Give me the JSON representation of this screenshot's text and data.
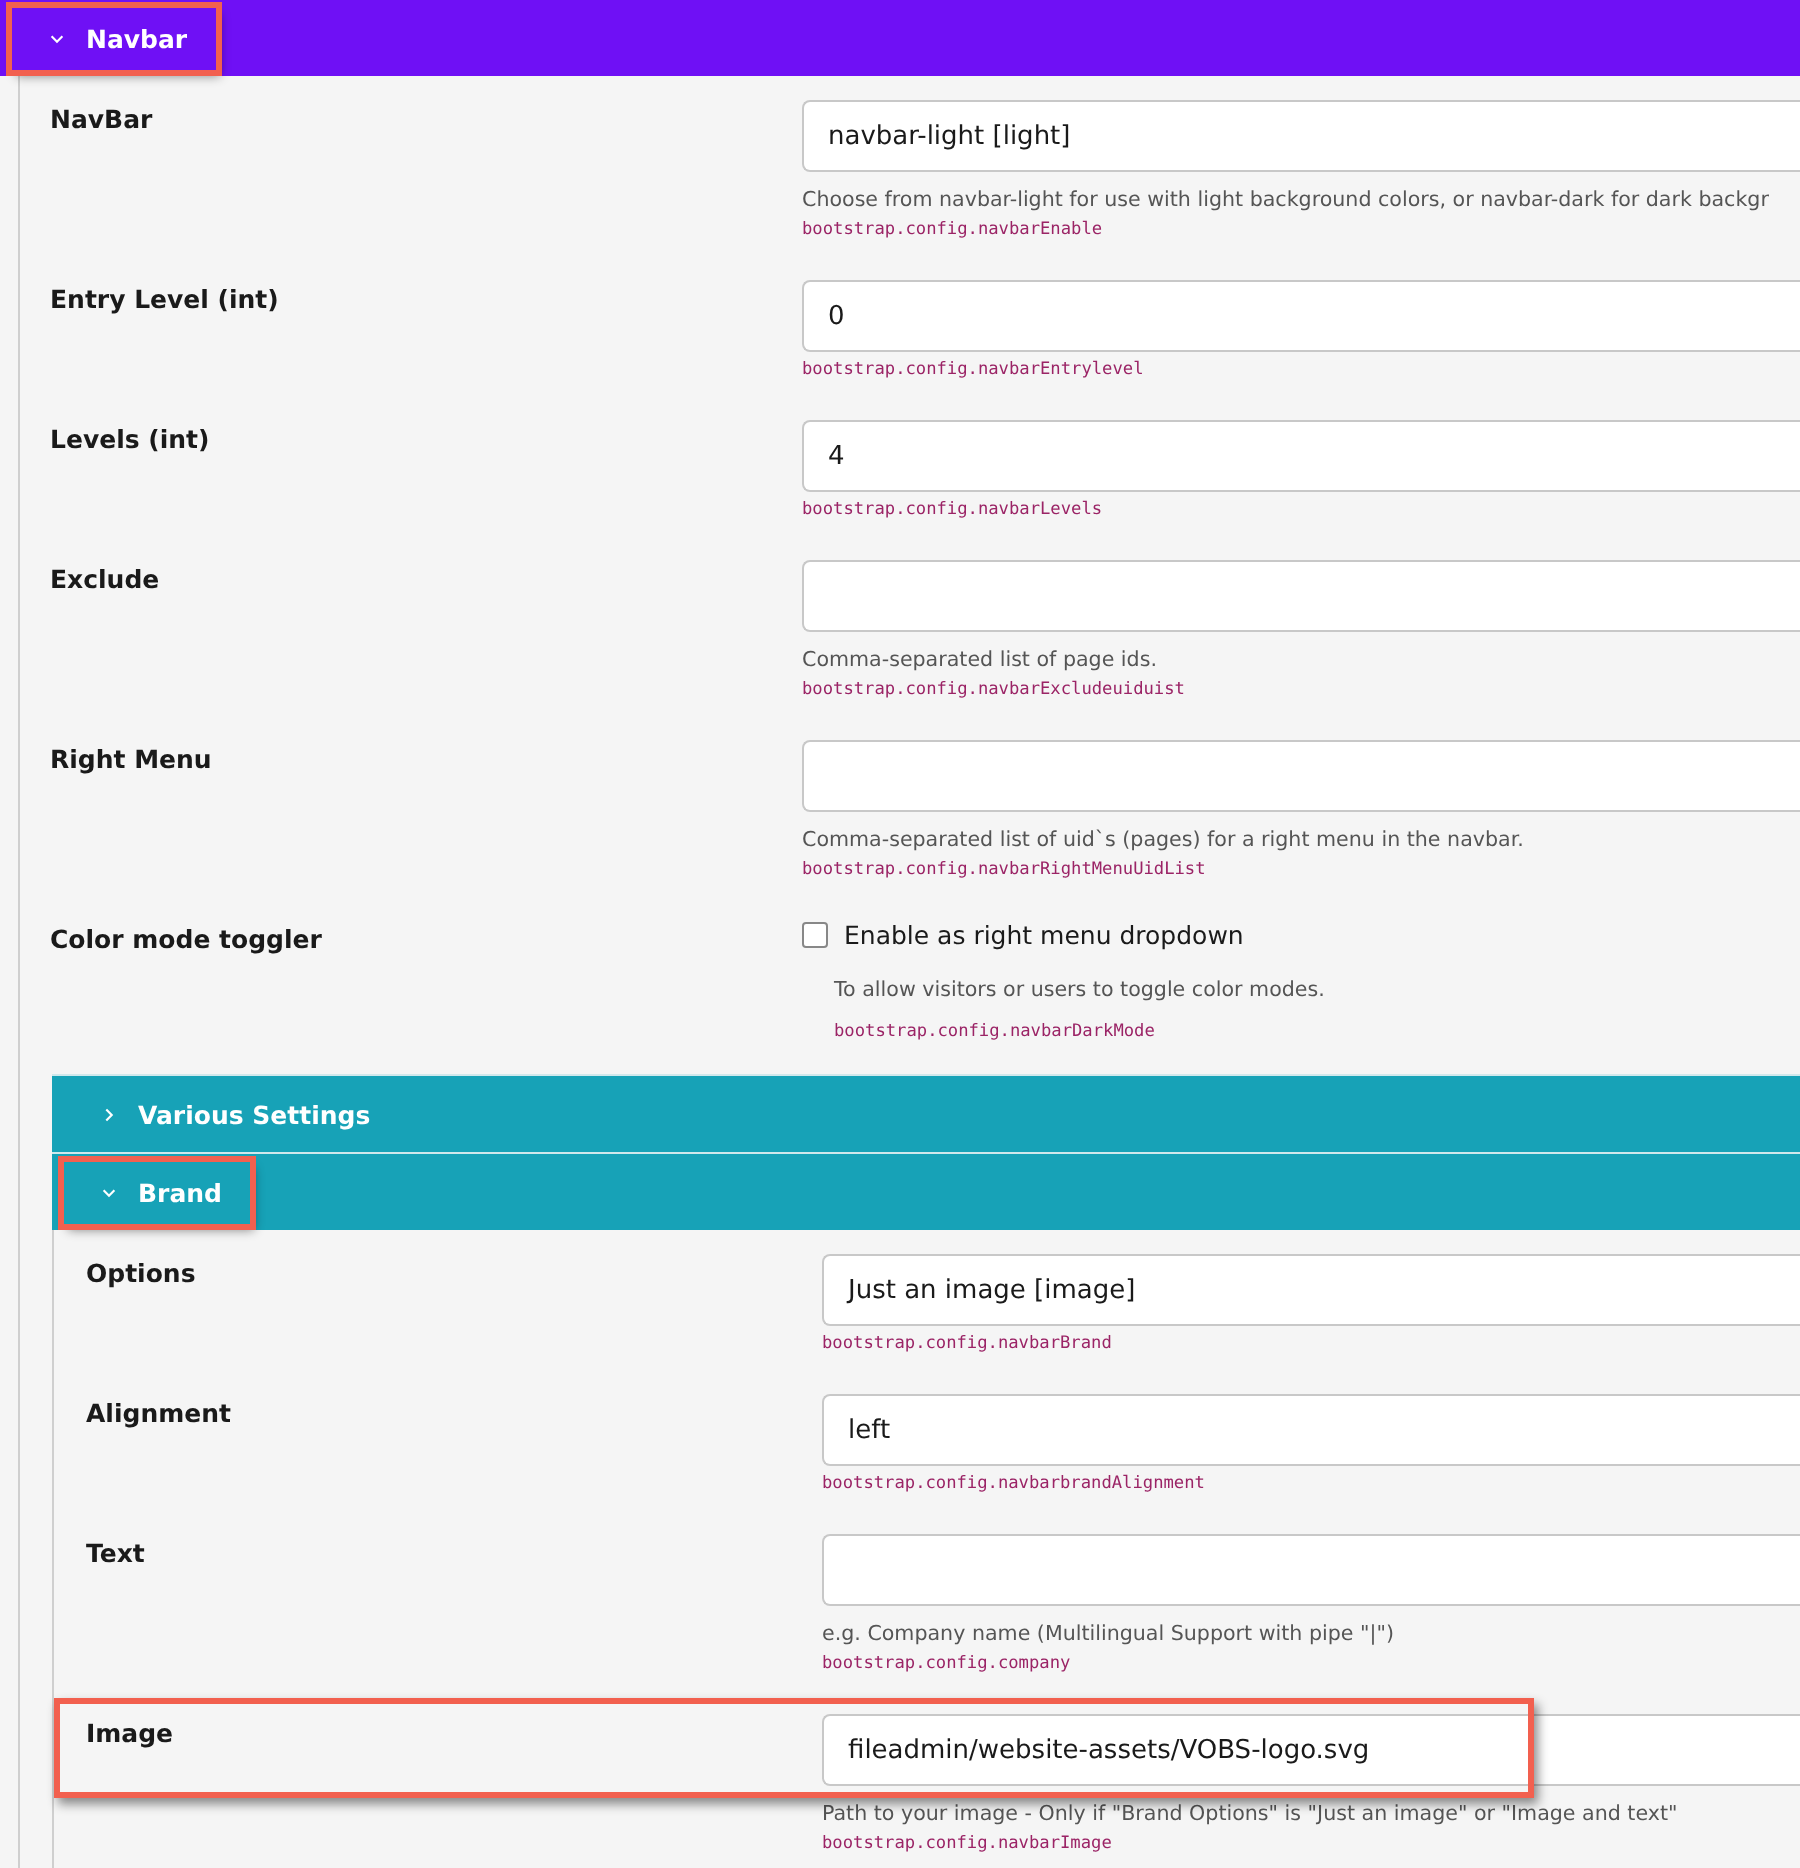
{
  "sections": [
    {
      "title": "Navbar",
      "expanded": true,
      "highlighted": true,
      "fields": [
        {
          "kind": "input",
          "label": "NavBar",
          "value": "navbar-light [light]",
          "help": "Choose from navbar-light for use with light background colors, or navbar-dark for dark backgr",
          "key": "bootstrap.config.navbarEnable",
          "highlighted": false
        },
        {
          "kind": "input",
          "label": "Entry Level (int)",
          "value": "0",
          "key": "bootstrap.config.navbarEntrylevel",
          "highlighted": false
        },
        {
          "kind": "input",
          "label": "Levels (int)",
          "value": "4",
          "key": "bootstrap.config.navbarLevels",
          "highlighted": false
        },
        {
          "kind": "input",
          "label": "Exclude",
          "help": "Comma-separated list of page ids.",
          "key": "bootstrap.config.navbarExcludeuiduist",
          "highlighted": false
        },
        {
          "kind": "input",
          "label": "Right Menu",
          "help": "Comma-separated list of uid`s (pages) for a right menu in the navbar.",
          "key": "bootstrap.config.navbarRightMenuUidList",
          "highlighted": false
        },
        {
          "kind": "checkbox",
          "label": "Color mode toggler",
          "option": "Enable as right menu dropdown",
          "checked": false,
          "help": "To allow visitors or users to toggle color modes.",
          "key": "bootstrap.config.navbarDarkMode",
          "highlighted": false
        }
      ],
      "subsections": [
        {
          "title": "Various Settings",
          "expanded": false,
          "highlighted": false
        },
        {
          "title": "Brand",
          "expanded": true,
          "highlighted": true,
          "fields": [
            {
              "kind": "input",
              "label": "Options",
              "value": "Just an image [image]",
              "key": "bootstrap.config.navbarBrand",
              "highlighted": false
            },
            {
              "kind": "input",
              "label": "Alignment",
              "value": "left",
              "key": "bootstrap.config.navbarbrandAlignment",
              "highlighted": false
            },
            {
              "kind": "input",
              "label": "Text",
              "help": "e.g. Company name (Multilingual Support with pipe \"|\")",
              "key": "bootstrap.config.company",
              "highlighted": false
            },
            {
              "kind": "input",
              "label": "Image",
              "value": "fileadmin/website-assets/VOBS-logo.svg",
              "help": "Path to your image - Only if \"Brand Options\" is \"Just an image\" or \"Image and text\"",
              "key": "bootstrap.config.navbarImage",
              "highlighted": true
            }
          ]
        }
      ]
    }
  ]
}
